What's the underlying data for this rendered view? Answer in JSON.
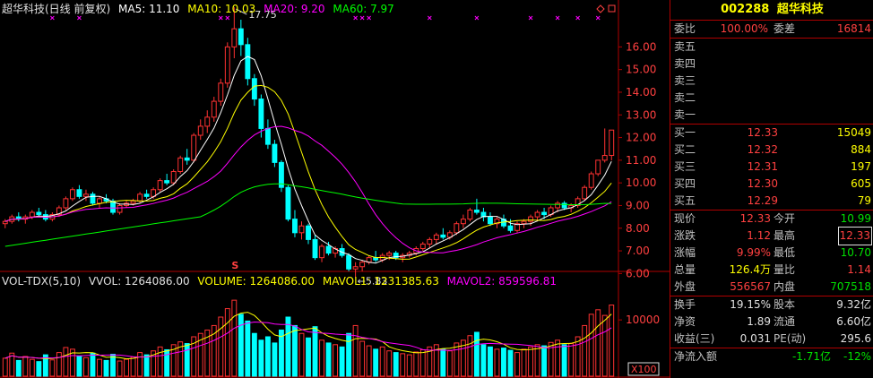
{
  "header": {
    "name": "超华科技(日线 前复权)",
    "ma5": "MA5: 11.10",
    "ma10": "MA10: 10.03",
    "ma20": "MA20: 9.20",
    "ma60": "MA60: 7.97"
  },
  "vol_header": {
    "name": "VOL-TDX(5,10)",
    "vvol": "VVOL: 1264086.00",
    "volume": "VOLUME: 1264086.00",
    "mavol1": "MAVOL1: 1231385.63",
    "mavol2": "MAVOL2: 859596.81"
  },
  "colors": {
    "up": "#ff3232",
    "down": "#00ffff",
    "ma5": "#ffffff",
    "ma10": "#ffff00",
    "ma20": "#ff00ff",
    "ma60": "#00ff00",
    "frame": "#b00000"
  },
  "price_axis": {
    "min": 5.5,
    "max": 17.2,
    "ticks": [
      "16.00",
      "15.00",
      "14.00",
      "13.00",
      "12.00",
      "11.00",
      "10.00",
      "9.00",
      "8.00",
      "7.00",
      "6.00"
    ]
  },
  "vol_axis": {
    "tick": "10000",
    "unit": "X100"
  },
  "annotations": {
    "high_label": "17.75",
    "low_label": "5.83",
    "event_marker": "S"
  },
  "chart_data": {
    "type": "candlestick",
    "ohlc": [
      [
        8.2,
        8.4,
        8.0,
        8.3
      ],
      [
        8.3,
        8.6,
        8.2,
        8.5
      ],
      [
        8.5,
        8.7,
        8.3,
        8.4
      ],
      [
        8.4,
        8.6,
        8.2,
        8.5
      ],
      [
        8.5,
        8.8,
        8.4,
        8.7
      ],
      [
        8.7,
        8.9,
        8.5,
        8.6
      ],
      [
        8.6,
        8.8,
        8.3,
        8.4
      ],
      [
        8.4,
        8.7,
        8.3,
        8.6
      ],
      [
        8.6,
        9.0,
        8.5,
        8.9
      ],
      [
        8.9,
        9.4,
        8.8,
        9.3
      ],
      [
        9.3,
        9.8,
        9.2,
        9.7
      ],
      [
        9.7,
        9.9,
        9.3,
        9.4
      ],
      [
        9.4,
        9.7,
        9.2,
        9.5
      ],
      [
        9.5,
        9.6,
        9.0,
        9.1
      ],
      [
        9.1,
        9.4,
        8.9,
        9.3
      ],
      [
        9.3,
        9.5,
        9.1,
        9.2
      ],
      [
        9.2,
        9.3,
        8.6,
        8.7
      ],
      [
        8.7,
        9.1,
        8.6,
        9.0
      ],
      [
        9.0,
        9.2,
        8.9,
        9.1
      ],
      [
        9.1,
        9.3,
        9.0,
        9.2
      ],
      [
        9.2,
        9.6,
        9.1,
        9.5
      ],
      [
        9.5,
        9.7,
        9.3,
        9.4
      ],
      [
        9.4,
        9.8,
        9.3,
        9.7
      ],
      [
        9.7,
        10.2,
        9.6,
        10.1
      ],
      [
        10.1,
        10.4,
        9.9,
        10.0
      ],
      [
        10.0,
        10.6,
        9.9,
        10.5
      ],
      [
        10.5,
        11.2,
        10.4,
        11.1
      ],
      [
        11.1,
        11.5,
        10.8,
        11.0
      ],
      [
        11.0,
        12.2,
        10.9,
        12.1
      ],
      [
        12.1,
        12.8,
        11.9,
        12.5
      ],
      [
        12.5,
        13.2,
        12.2,
        12.9
      ],
      [
        12.9,
        13.8,
        12.7,
        13.6
      ],
      [
        13.6,
        14.6,
        13.4,
        14.4
      ],
      [
        14.4,
        16.2,
        14.2,
        16.0
      ],
      [
        16.0,
        17.75,
        15.5,
        16.8
      ],
      [
        16.8,
        17.2,
        15.6,
        16.1
      ],
      [
        16.1,
        16.4,
        14.3,
        14.6
      ],
      [
        14.6,
        14.8,
        13.4,
        13.7
      ],
      [
        13.7,
        13.9,
        12.0,
        12.4
      ],
      [
        12.4,
        12.8,
        11.5,
        11.7
      ],
      [
        11.7,
        11.9,
        10.7,
        10.9
      ],
      [
        10.9,
        11.0,
        9.6,
        9.8
      ],
      [
        9.8,
        9.9,
        8.3,
        8.4
      ],
      [
        8.4,
        8.8,
        7.6,
        7.8
      ],
      [
        7.8,
        8.3,
        7.5,
        8.1
      ],
      [
        8.1,
        8.2,
        7.3,
        7.5
      ],
      [
        7.5,
        7.7,
        6.6,
        6.7
      ],
      [
        6.7,
        7.3,
        6.5,
        7.2
      ],
      [
        7.2,
        7.4,
        6.8,
        6.9
      ],
      [
        6.9,
        7.2,
        6.7,
        7.1
      ],
      [
        7.1,
        7.3,
        6.7,
        6.8
      ],
      [
        6.8,
        6.9,
        6.1,
        6.2
      ],
      [
        6.2,
        6.5,
        5.83,
        6.3
      ],
      [
        6.3,
        6.6,
        6.1,
        6.5
      ],
      [
        6.5,
        6.8,
        6.4,
        6.7
      ],
      [
        6.7,
        7.0,
        6.5,
        6.6
      ],
      [
        6.6,
        6.9,
        6.5,
        6.8
      ],
      [
        6.8,
        7.0,
        6.6,
        6.9
      ],
      [
        6.9,
        7.0,
        6.6,
        6.7
      ],
      [
        6.7,
        6.9,
        6.5,
        6.8
      ],
      [
        6.8,
        7.0,
        6.7,
        6.9
      ],
      [
        6.9,
        7.2,
        6.8,
        7.1
      ],
      [
        7.1,
        7.4,
        7.0,
        7.3
      ],
      [
        7.3,
        7.6,
        7.1,
        7.5
      ],
      [
        7.5,
        7.8,
        7.3,
        7.7
      ],
      [
        7.7,
        8.0,
        7.5,
        7.6
      ],
      [
        7.6,
        7.9,
        7.5,
        7.8
      ],
      [
        7.8,
        8.3,
        7.7,
        8.2
      ],
      [
        8.2,
        8.6,
        8.0,
        8.4
      ],
      [
        8.4,
        8.9,
        8.3,
        8.8
      ],
      [
        8.8,
        9.3,
        8.6,
        8.7
      ],
      [
        8.7,
        8.9,
        8.3,
        8.5
      ],
      [
        8.5,
        8.7,
        8.1,
        8.2
      ],
      [
        8.2,
        8.5,
        8.0,
        8.4
      ],
      [
        8.4,
        8.6,
        8.0,
        8.1
      ],
      [
        8.1,
        8.4,
        7.8,
        7.9
      ],
      [
        7.9,
        8.3,
        7.8,
        8.2
      ],
      [
        8.2,
        8.4,
        8.0,
        8.3
      ],
      [
        8.3,
        8.6,
        8.1,
        8.5
      ],
      [
        8.5,
        8.8,
        8.3,
        8.7
      ],
      [
        8.7,
        8.9,
        8.4,
        8.6
      ],
      [
        8.6,
        9.0,
        8.5,
        8.9
      ],
      [
        8.9,
        9.2,
        8.7,
        9.1
      ],
      [
        9.1,
        9.2,
        8.8,
        8.9
      ],
      [
        8.9,
        9.1,
        8.7,
        9.0
      ],
      [
        9.0,
        9.4,
        8.9,
        9.3
      ],
      [
        9.3,
        9.9,
        9.2,
        9.8
      ],
      [
        9.8,
        10.5,
        9.7,
        10.4
      ],
      [
        10.4,
        11.0,
        10.3,
        11.0
      ],
      [
        11.0,
        12.4,
        10.9,
        11.21
      ],
      [
        11.21,
        12.33,
        10.99,
        12.33
      ]
    ],
    "volumes": [
      320,
      410,
      280,
      350,
      300,
      260,
      380,
      290,
      420,
      510,
      480,
      360,
      330,
      410,
      300,
      280,
      390,
      270,
      300,
      340,
      420,
      380,
      450,
      520,
      470,
      560,
      610,
      580,
      700,
      760,
      820,
      900,
      1050,
      1200,
      1350,
      1100,
      980,
      760,
      640,
      700,
      590,
      820,
      1050,
      900,
      760,
      680,
      880,
      640,
      590,
      560,
      520,
      760,
      900,
      620,
      540,
      480,
      520,
      450,
      420,
      400,
      380,
      430,
      470,
      520,
      560,
      480,
      450,
      590,
      640,
      720,
      780,
      560,
      520,
      480,
      500,
      460,
      420,
      480,
      520,
      560,
      540,
      600,
      640,
      560,
      580,
      700,
      900,
      1100,
      1180,
      1080,
      1264
    ]
  },
  "quote": {
    "code": "002288",
    "name": "超华科技",
    "wei_bi_label": "委比",
    "wei_bi": "100.00%",
    "wei_cha_label": "委差",
    "wei_cha": "16814",
    "sell": [
      {
        "label": "卖五",
        "price": "",
        "vol": ""
      },
      {
        "label": "卖四",
        "price": "",
        "vol": ""
      },
      {
        "label": "卖三",
        "price": "",
        "vol": ""
      },
      {
        "label": "卖二",
        "price": "",
        "vol": ""
      },
      {
        "label": "卖一",
        "price": "",
        "vol": ""
      }
    ],
    "buy": [
      {
        "label": "买一",
        "price": "12.33",
        "vol": "15049"
      },
      {
        "label": "买二",
        "price": "12.32",
        "vol": "884"
      },
      {
        "label": "买三",
        "price": "12.31",
        "vol": "197"
      },
      {
        "label": "买四",
        "price": "12.30",
        "vol": "605"
      },
      {
        "label": "买五",
        "price": "12.29",
        "vol": "79"
      }
    ],
    "stats": [
      {
        "l1": "现价",
        "v1": "12.33",
        "l2": "今开",
        "v2": "10.99"
      },
      {
        "l1": "涨跌",
        "v1": "1.12",
        "l2": "最高",
        "v2": "12.33"
      },
      {
        "l1": "涨幅",
        "v1": "9.99%",
        "l2": "最低",
        "v2": "10.70"
      },
      {
        "l1": "总量",
        "v1": "126.4万",
        "l2": "量比",
        "v2": "1.14"
      },
      {
        "l1": "外盘",
        "v1": "556567",
        "l2": "内盘",
        "v2": "707518"
      }
    ],
    "fund": [
      {
        "l1": "换手",
        "v1": "19.15%",
        "l2": "股本",
        "v2": "9.32亿"
      },
      {
        "l1": "净资",
        "v1": "1.89",
        "l2": "流通",
        "v2": "6.60亿"
      },
      {
        "l1": "收益(三)",
        "v1": "0.031",
        "l2": "PE(动)",
        "v2": "295.6"
      }
    ],
    "flow_label": "净流入额",
    "flow_value": "-1.71亿",
    "flow_pct": "-12%"
  }
}
